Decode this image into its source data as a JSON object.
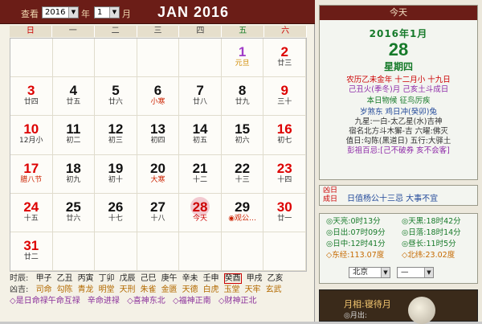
{
  "toolbar": {
    "view_label": "查看",
    "year_value": "2016",
    "year_suffix": "年",
    "month_value": "1",
    "month_suffix": "月",
    "month_title": "JAN 2016"
  },
  "weekdays": [
    "日",
    "一",
    "二",
    "三",
    "四",
    "五",
    "六"
  ],
  "cells": [
    {
      "num": "",
      "sub": ""
    },
    {
      "num": "",
      "sub": ""
    },
    {
      "num": "",
      "sub": ""
    },
    {
      "num": "",
      "sub": ""
    },
    {
      "num": "",
      "sub": ""
    },
    {
      "num": "1",
      "sub": "元旦",
      "type": "purple"
    },
    {
      "num": "2",
      "sub": "廿三",
      "type": "red"
    },
    {
      "num": "3",
      "sub": "廿四",
      "type": "red"
    },
    {
      "num": "4",
      "sub": "廿五"
    },
    {
      "num": "5",
      "sub": "廿六"
    },
    {
      "num": "6",
      "sub": "小寒",
      "type": "fest"
    },
    {
      "num": "7",
      "sub": "廿八"
    },
    {
      "num": "8",
      "sub": "廿九"
    },
    {
      "num": "9",
      "sub": "三十",
      "type": "red"
    },
    {
      "num": "10",
      "sub": "12月小",
      "type": "red"
    },
    {
      "num": "11",
      "sub": "初二"
    },
    {
      "num": "12",
      "sub": "初三"
    },
    {
      "num": "13",
      "sub": "初四"
    },
    {
      "num": "14",
      "sub": "初五"
    },
    {
      "num": "15",
      "sub": "初六"
    },
    {
      "num": "16",
      "sub": "初七",
      "type": "red"
    },
    {
      "num": "17",
      "sub": "腊八节",
      "type": "red fest"
    },
    {
      "num": "18",
      "sub": "初九"
    },
    {
      "num": "19",
      "sub": "初十"
    },
    {
      "num": "20",
      "sub": "大寒",
      "type": "fest"
    },
    {
      "num": "21",
      "sub": "十二"
    },
    {
      "num": "22",
      "sub": "十三"
    },
    {
      "num": "23",
      "sub": "十四",
      "type": "red"
    },
    {
      "num": "24",
      "sub": "十五",
      "type": "red"
    },
    {
      "num": "25",
      "sub": "廿六"
    },
    {
      "num": "26",
      "sub": "十七"
    },
    {
      "num": "27",
      "sub": "十八"
    },
    {
      "num": "28",
      "sub": "今天",
      "type": "today"
    },
    {
      "num": "29",
      "sub": "◉观公…",
      "type": "fest"
    },
    {
      "num": "30",
      "sub": "廿一",
      "type": "red"
    },
    {
      "num": "31",
      "sub": "廿二",
      "type": "red"
    },
    {
      "num": "",
      "sub": ""
    },
    {
      "num": "",
      "sub": ""
    },
    {
      "num": "",
      "sub": ""
    },
    {
      "num": "",
      "sub": ""
    },
    {
      "num": "",
      "sub": ""
    },
    {
      "num": "",
      "sub": ""
    }
  ],
  "bottom": {
    "hours_label": "时辰:",
    "hours": [
      "甲子",
      "乙丑",
      "丙寅",
      "丁卯",
      "戊辰",
      "己巳",
      "庚午",
      "辛未",
      "壬申",
      "癸酉",
      "甲戌",
      "乙亥"
    ],
    "gods_label": "凶吉:",
    "gods": [
      "司命",
      "勾陈",
      "青龙",
      "明堂",
      "天刑",
      "朱雀",
      "金匮",
      "天德",
      "白虎",
      "玉堂",
      "天牢",
      "玄武"
    ],
    "line3": [
      "◇是日命禄午命互禄",
      "辛命进禄",
      "◇喜神东北",
      "◇福神正南",
      "◇财神正北"
    ]
  },
  "today_panel": {
    "header": "今天",
    "date_line": "2016年1月",
    "day": "28",
    "weekday": "星期四",
    "lunar": "农历乙未金年 十二月小 十九日",
    "ganzhi": "己丑火(季冬)月 己亥土斗成日",
    "birth": "本日物候 征鸟厉疾",
    "sha": "岁煞东 鸡日冲(癸卯)兔",
    "jiuxing": "九星:一白-太乙星(水)吉神",
    "xiu": "宿名北方斗木獬-吉 六曜:佛灭",
    "zhiri": "值日:勾陈(黑道日) 五行:大驿土",
    "pengzu": "彭祖百忌:[己不破券 亥不会客]",
    "xiong_tag": "凶日 成日",
    "xiong_text": "日值杨公十三忌 大事不宜"
  },
  "sun_panel": {
    "row1": [
      "◎天亮:0时13分",
      "◎天黑:18时42分"
    ],
    "row2": [
      "◎日出:07时09分",
      "◎日落:18时14分"
    ],
    "row3": [
      "◎日中:12时41分",
      "◎昼长:11时5分"
    ],
    "row4": [
      "◇东经:113.07度",
      "◇北纬:23.02度"
    ],
    "city": "北京",
    "district": "—"
  },
  "moon_panel": {
    "title": "月相:寝待月",
    "sub": "◎月出:"
  }
}
